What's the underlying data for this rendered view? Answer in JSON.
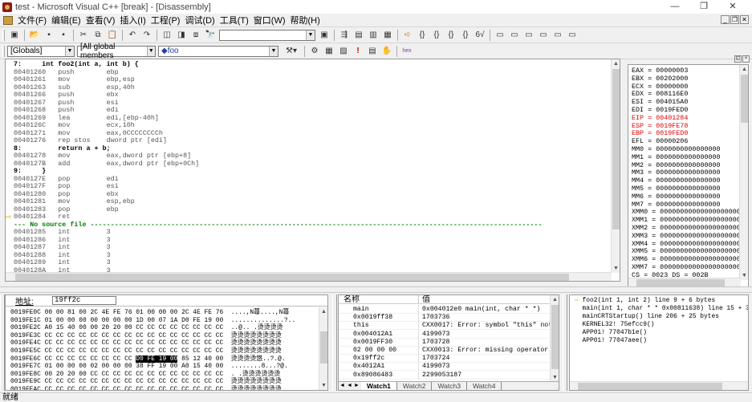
{
  "window": {
    "title": "test - Microsoft Visual C++ [break] - [Disassembly]",
    "min_glyph": "—",
    "restore_glyph": "❐",
    "close_glyph": "✕"
  },
  "menu": [
    "文件(F)",
    "编辑(E)",
    "查看(V)",
    "插入(I)",
    "工程(P)",
    "调试(D)",
    "工具(T)",
    "窗口(W)",
    "帮助(H)"
  ],
  "toolbar2": {
    "globals": "[Globals]",
    "members": "[All global members",
    "function": "◆foo"
  },
  "disassembly": [
    {
      "kind": "src",
      "text": "7:     int foo2(int a, int b) {"
    },
    {
      "kind": "asm",
      "text": "00401260   push        ebp"
    },
    {
      "kind": "asm",
      "text": "00401261   mov         ebp,esp"
    },
    {
      "kind": "asm",
      "text": "00401263   sub         esp,40h"
    },
    {
      "kind": "asm",
      "text": "00401266   push        ebx"
    },
    {
      "kind": "asm",
      "text": "00401267   push        esi"
    },
    {
      "kind": "asm",
      "text": "00401268   push        edi"
    },
    {
      "kind": "asm",
      "text": "00401269   lea         edi,[ebp-40h]"
    },
    {
      "kind": "asm",
      "text": "0040126C   mov         ecx,10h"
    },
    {
      "kind": "asm",
      "text": "00401271   mov         eax,0CCCCCCCCh"
    },
    {
      "kind": "asm",
      "text": "00401276   rep stos    dword ptr [edi]"
    },
    {
      "kind": "src",
      "text": "8:         return a + b;"
    },
    {
      "kind": "asm",
      "text": "00401278   mov         eax,dword ptr [ebp+8]"
    },
    {
      "kind": "asm",
      "text": "0040127B   add         eax,dword ptr [ebp+0Ch]"
    },
    {
      "kind": "src",
      "text": "9:     }"
    },
    {
      "kind": "asm",
      "text": "0040127E   pop         edi"
    },
    {
      "kind": "asm",
      "text": "0040127F   pop         esi"
    },
    {
      "kind": "asm",
      "text": "00401280   pop         ebx"
    },
    {
      "kind": "asm",
      "text": "00401281   mov         esp,ebp"
    },
    {
      "kind": "asm",
      "text": "00401283   pop         ebp"
    },
    {
      "kind": "asm",
      "text": "00401284   ret",
      "current": true
    },
    {
      "kind": "nosrc",
      "text": "--- No source file ----------------------------------------------------------------------------------------------------------------"
    },
    {
      "kind": "asm",
      "text": "00401285   int         3"
    },
    {
      "kind": "asm",
      "text": "00401286   int         3"
    },
    {
      "kind": "asm",
      "text": "00401287   int         3"
    },
    {
      "kind": "asm",
      "text": "00401288   int         3"
    },
    {
      "kind": "asm",
      "text": "00401289   int         3"
    },
    {
      "kind": "asm",
      "text": "0040128A   int         3"
    },
    {
      "kind": "asm",
      "text": "0040128B   int         3"
    }
  ],
  "eip_marker": "⇨",
  "registers": [
    {
      "text": "EAX = 00000003",
      "changed": false
    },
    {
      "text": "EBX = 00202000",
      "changed": false
    },
    {
      "text": "ECX = 00000000",
      "changed": false
    },
    {
      "text": "EDX = 008116E0",
      "changed": false
    },
    {
      "text": "ESI = 004015A0",
      "changed": false
    },
    {
      "text": "EDI = 0019FED0",
      "changed": false
    },
    {
      "text": "EIP = 00401284",
      "changed": true
    },
    {
      "text": "ESP = 0019FE78",
      "changed": true
    },
    {
      "text": "EBP = 0019FED0",
      "changed": true
    },
    {
      "text": "EFL = 00000206",
      "changed": false
    },
    {
      "text": "MM0 = 0000000000000000",
      "changed": false
    },
    {
      "text": "MM1 = 0000000000000000",
      "changed": false
    },
    {
      "text": "MM2 = 0000000000000000",
      "changed": false
    },
    {
      "text": "MM3 = 0000000000000000",
      "changed": false
    },
    {
      "text": "MM4 = 0000000000000000",
      "changed": false
    },
    {
      "text": "MM5 = 0000000000000000",
      "changed": false
    },
    {
      "text": "MM6 = 0000000000000000",
      "changed": false
    },
    {
      "text": "MM7 = 0000000000000000",
      "changed": false
    },
    {
      "text": "XMM0 = 0000000000000000000000",
      "changed": false
    },
    {
      "text": "XMM1 = 0000000000000000000000",
      "changed": false
    },
    {
      "text": "XMM2 = 0000000000000000000000",
      "changed": false
    },
    {
      "text": "XMM3 = 0000000000000000000000",
      "changed": false
    },
    {
      "text": "XMM4 = 0000000000000000000000",
      "changed": false
    },
    {
      "text": "XMM5 = 0000000000000000000000",
      "changed": false
    },
    {
      "text": "XMM6 = 0000000000000000000000",
      "changed": false
    },
    {
      "text": "XMM7 = 0000000000000000000000",
      "changed": false
    },
    {
      "text": "CS = 0023 DS = 002B",
      "changed": false
    }
  ],
  "memory": {
    "address_label": "地址:",
    "address_value": "19ff2c",
    "rows": [
      {
        "addr": "0019FE0C",
        "hex": "00 00 81 00 2C 4E FE 76 01 00 00 00 2C 4E FE 76",
        "ascii": "....,N蕁....,N蕁"
      },
      {
        "addr": "0019FE1C",
        "hex": "01 00 00 00 00 00 00 00 1D 00 07 1A D0 FE 19 00",
        "ascii": "..............?.."
      },
      {
        "addr": "0019FE2C",
        "hex": "A0 15 40 00 00 20 20 00 CC CC CC CC CC CC CC CC",
        "ascii": "..@.. .烫烫烫烫"
      },
      {
        "addr": "0019FE3C",
        "hex": "CC CC CC CC CC CC CC CC CC CC CC CC CC CC CC CC",
        "ascii": "烫烫烫烫烫烫烫烫"
      },
      {
        "addr": "0019FE4C",
        "hex": "CC CC CC CC CC CC CC CC CC CC CC CC CC CC CC CC",
        "ascii": "烫烫烫烫烫烫烫烫"
      },
      {
        "addr": "0019FE5C",
        "hex": "CC CC CC CC CC CC CC CC CC CC CC CC CC CC CC CC",
        "ascii": "烫烫烫烫烫烫烫烫"
      },
      {
        "addr": "0019FE6C",
        "hex_before": "CC CC CC CC CC CC CC CC ",
        "hex_hl": "D0 FE 19 00",
        "hex_after": " 85 12 40 00",
        "ascii": "烫烫烫烫悠..?.@."
      },
      {
        "addr": "0019FE7C",
        "hex": "01 00 00 00 02 00 00 00 38 FF 19 00 A0 15 40 00",
        "ascii": "........8...?@."
      },
      {
        "addr": "0019FE8C",
        "hex": "00 20 20 00 CC CC CC CC CC CC CC CC CC CC CC CC",
        "ascii": ". .烫烫烫烫烫烫"
      },
      {
        "addr": "0019FE9C",
        "hex": "CC CC CC CC CC CC CC CC CC CC CC CC CC CC CC CC",
        "ascii": "烫烫烫烫烫烫烫烫"
      },
      {
        "addr": "0019FEAC",
        "hex": "CC CC CC CC CC CC CC CC CC CC CC CC CC CC CC CC",
        "ascii": "烫烫烫烫烫烫烫烫"
      }
    ]
  },
  "watch": {
    "col_name": "名称",
    "col_value": "值",
    "rows": [
      {
        "name": "main",
        "value": "0x004012e0 main(int, char * *)"
      },
      {
        "name": "0x0019ff38",
        "value": "1703736"
      },
      {
        "name": "this",
        "value": "CXX0017: Error: symbol \"this\" not found"
      },
      {
        "name": "0x004012A1",
        "value": "4199073"
      },
      {
        "name": "0x0019FF30",
        "value": "1703728"
      },
      {
        "name": "02 00 00 00",
        "value": "CXX0013: Error: missing operator"
      },
      {
        "name": "0x19ff2c",
        "value": "1703724"
      },
      {
        "name": "0x4012A1",
        "value": "4199073"
      },
      {
        "name": "0x89086483",
        "value": "2299053187"
      }
    ],
    "tabs": [
      "Watch1",
      "Watch2",
      "Watch3",
      "Watch4"
    ],
    "active_tab": 0
  },
  "callstack": [
    {
      "text": "foo2(int 1, int 2) line 9 + 6 bytes",
      "current": true
    },
    {
      "text": "main(int 1, char * * 0x00811638) line 15 + 3",
      "current": false
    },
    {
      "text": "mainCRTStartup() line 206 + 25 bytes",
      "current": false
    },
    {
      "text": "KERNEL32! 75efcc9()",
      "current": false
    },
    {
      "text": "APP01! 77047b1e()",
      "current": false
    },
    {
      "text": "APP01! 77047aee()",
      "current": false
    }
  ],
  "status": "就绪"
}
